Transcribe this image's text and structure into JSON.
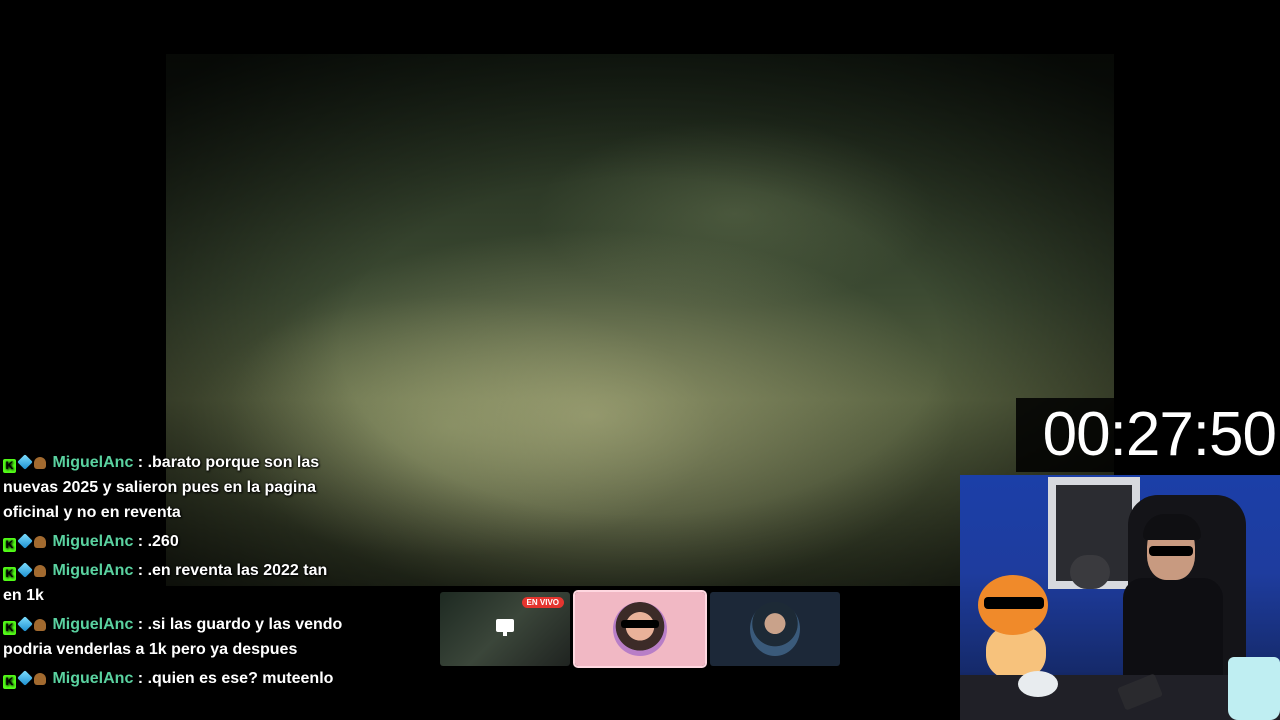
{
  "timer": "00:27:50",
  "chat": [
    {
      "user": "MiguelAnc",
      "separator": ":",
      "text": ".barato porque son las nuevas 2025 y salieron pues en la pagina oficinal y no en reventa"
    },
    {
      "user": "MiguelAnc",
      "separator": ":",
      "text": ".260"
    },
    {
      "user": "MiguelAnc",
      "separator": ":",
      "text": ".en reventa las 2022 tan en 1k"
    },
    {
      "user": "MiguelAnc",
      "separator": ":",
      "text": ".si las guardo y las vendo podria venderlas a 1k pero ya despues"
    },
    {
      "user": "MiguelAnc",
      "separator": ":",
      "text": ".quien es ese? muteenlo"
    }
  ],
  "badges": {
    "kick": "K",
    "kick_color": "#53fc18",
    "username_color": "#5ad2a0"
  },
  "thumbnails": {
    "live_label": "EN VIVO",
    "live_color": "#e5352f"
  },
  "icons": [
    "kick-badge-icon",
    "cube-badge-icon",
    "crown-badge-icon",
    "screen-share-icon"
  ]
}
